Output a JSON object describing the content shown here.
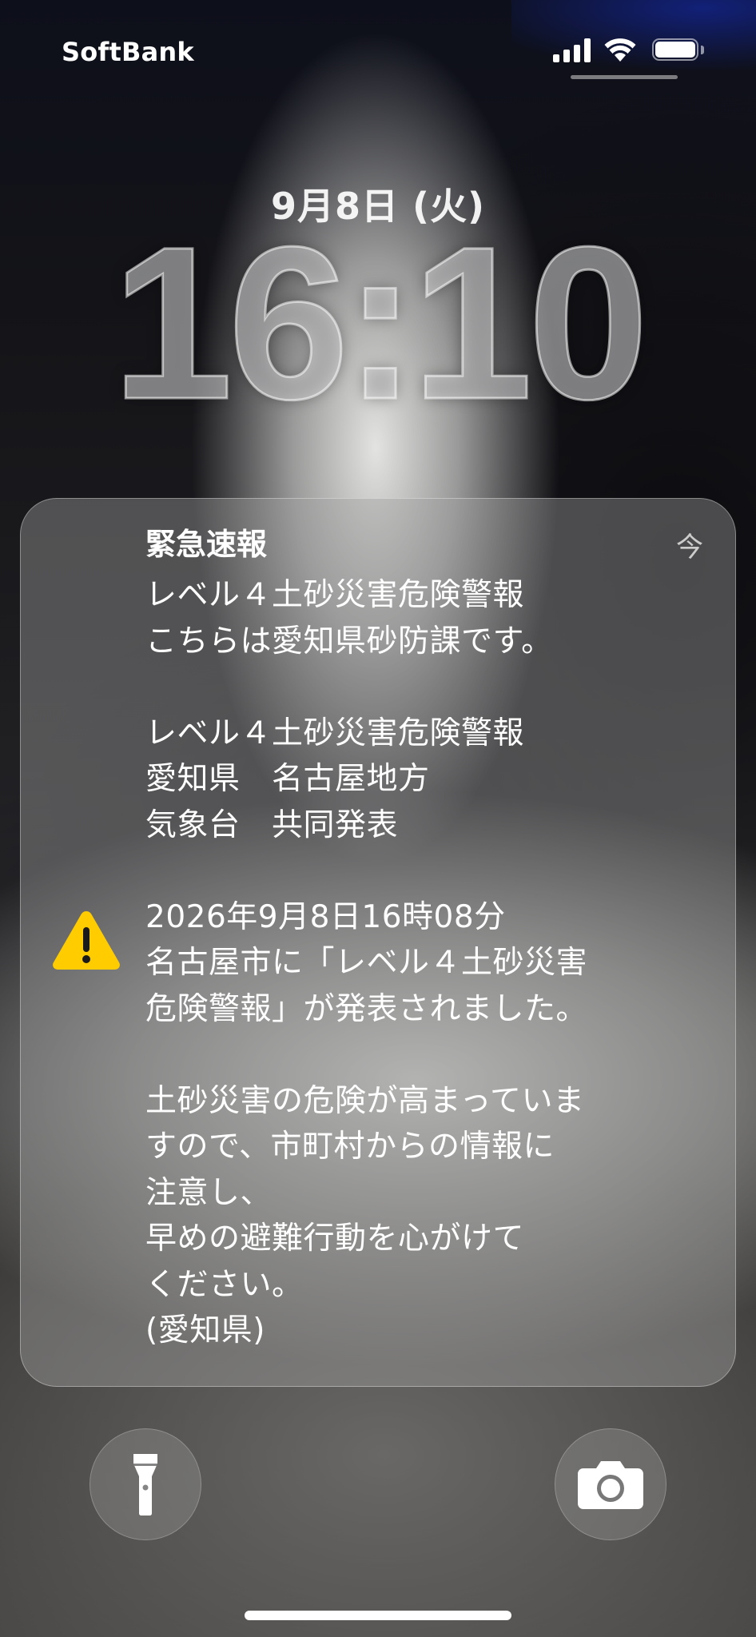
{
  "status_bar": {
    "carrier": "SoftBank",
    "signal_icon": "cellular-signal-icon",
    "wifi_icon": "wifi-icon",
    "battery_icon": "battery-full-icon"
  },
  "lock_screen": {
    "date": "9月8日 (火)",
    "time": "16:10"
  },
  "notification": {
    "icon": "warning-triangle-icon",
    "accent_color": "#FFCC00",
    "title": "緊急速報",
    "time": "今",
    "body": "レベル４土砂災害危険警報\nこちらは愛知県砂防課です。\n\nレベル４土砂災害危険警報\n愛知県　名古屋地方\n気象台　共同発表\n\n2026年9月8日16時08分\n名古屋市に「レベル４土砂災害\n危険警報」が発表されました。\n\n土砂災害の危険が高まっていま\nすので、市町村からの情報に\n注意し、\n早めの避難行動を心がけて\nください。\n(愛知県)"
  },
  "controls": {
    "flashlight_icon": "flashlight-icon",
    "camera_icon": "camera-icon"
  }
}
